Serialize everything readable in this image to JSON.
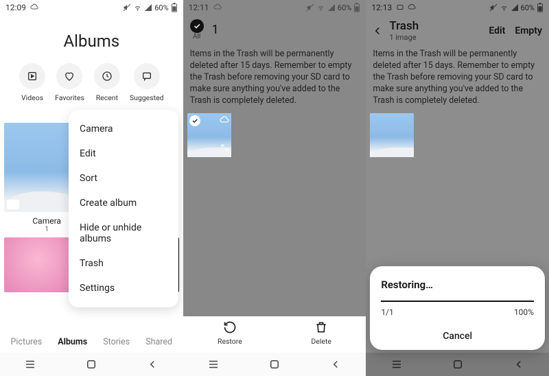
{
  "s1": {
    "time": "12:09",
    "battery": "60%",
    "title": "Albums",
    "chips": [
      {
        "label": "Videos"
      },
      {
        "label": "Favorites"
      },
      {
        "label": "Recent"
      },
      {
        "label": "Suggested"
      }
    ],
    "album": {
      "name": "Camera",
      "count": "1"
    },
    "tabs": [
      "Pictures",
      "Albums",
      "Stories",
      "Shared"
    ],
    "active_tab": "Albums",
    "menu": [
      "Camera",
      "Edit",
      "Sort",
      "Create album",
      "Hide or unhide albums",
      "Trash",
      "Settings"
    ]
  },
  "s2": {
    "time": "12:11",
    "battery": "60%",
    "all_label": "All",
    "selected_count": "1",
    "message": "Items in the Trash will be permanently deleted after 15 days. Remember to empty the Trash before removing your SD card to make sure anything you've added to the Trash is completely deleted.",
    "actions": {
      "restore": "Restore",
      "delete": "Delete"
    }
  },
  "s3": {
    "time": "12:13",
    "battery": "60%",
    "title": "Trash",
    "subtitle": "1 image",
    "header_actions": {
      "edit": "Edit",
      "empty": "Empty"
    },
    "message": "Items in the Trash will be permanently deleted after 15 days. Remember to empty the Trash before removing your SD card to make sure anything you've added to the Trash is completely deleted.",
    "dialog": {
      "title": "Restoring…",
      "progress_label": "1/1",
      "percent_label": "100%",
      "cancel": "Cancel"
    }
  }
}
